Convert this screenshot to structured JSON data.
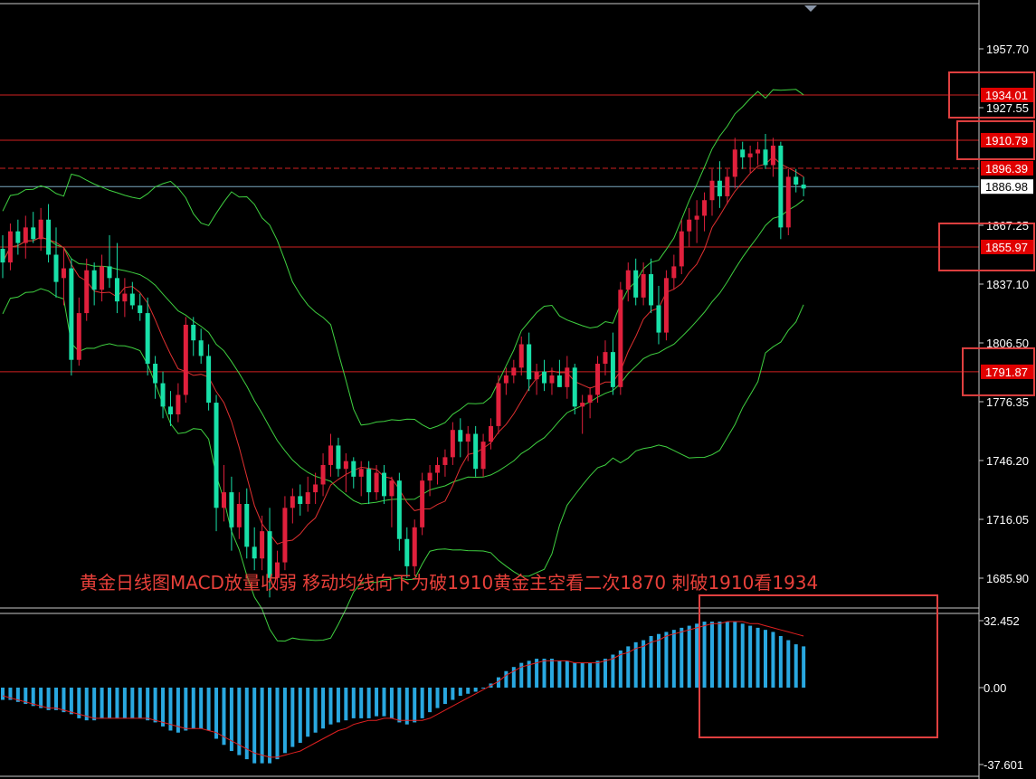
{
  "chart_data": {
    "type": "candlestick",
    "title": "",
    "annotation": "黄金日线图MACD放量收弱 移动均线向下为破1910黄金主空看二次1870 刺破1910看1934",
    "price_axis": {
      "ticks": [
        "1957.70",
        "1927.55",
        "1867.25",
        "1837.10",
        "1806.50",
        "1776.35",
        "1746.20",
        "1716.05",
        "1685.90"
      ],
      "range": [
        1676,
        1975
      ]
    },
    "macd_axis": {
      "ticks": [
        "32.452",
        "0.00",
        "-37.601"
      ],
      "range": [
        -37.601,
        32.452
      ]
    },
    "horizontal_levels": [
      {
        "label": "1934.01",
        "value": 1934.01,
        "boxed": true
      },
      {
        "label": "1910.79",
        "value": 1910.79,
        "boxed": true
      },
      {
        "label": "1896.39",
        "value": 1896.39,
        "boxed": true
      },
      {
        "label": "1855.97",
        "value": 1855.97,
        "boxed": true
      },
      {
        "label": "1791.87",
        "value": 1791.87,
        "boxed": true
      }
    ],
    "current_price": {
      "label": "1886.98",
      "value": 1886.98
    },
    "candles": [
      [
        1855,
        1862,
        1840,
        1848
      ],
      [
        1848,
        1868,
        1844,
        1864
      ],
      [
        1864,
        1870,
        1852,
        1858
      ],
      [
        1858,
        1872,
        1850,
        1866
      ],
      [
        1866,
        1874,
        1858,
        1860
      ],
      [
        1860,
        1876,
        1854,
        1870
      ],
      [
        1870,
        1878,
        1848,
        1852
      ],
      [
        1852,
        1866,
        1830,
        1838
      ],
      [
        1840,
        1856,
        1826,
        1845
      ],
      [
        1845,
        1850,
        1790,
        1798
      ],
      [
        1798,
        1830,
        1795,
        1822
      ],
      [
        1822,
        1850,
        1818,
        1844
      ],
      [
        1844,
        1848,
        1826,
        1834
      ],
      [
        1834,
        1852,
        1828,
        1846
      ],
      [
        1846,
        1862,
        1835,
        1840
      ],
      [
        1840,
        1858,
        1822,
        1828
      ],
      [
        1828,
        1840,
        1820,
        1832
      ],
      [
        1832,
        1838,
        1824,
        1826
      ],
      [
        1826,
        1832,
        1818,
        1822
      ],
      [
        1822,
        1830,
        1790,
        1796
      ],
      [
        1796,
        1800,
        1778,
        1786
      ],
      [
        1786,
        1792,
        1768,
        1774
      ],
      [
        1774,
        1782,
        1764,
        1770
      ],
      [
        1770,
        1786,
        1766,
        1780
      ],
      [
        1780,
        1820,
        1776,
        1816
      ],
      [
        1816,
        1820,
        1800,
        1808
      ],
      [
        1808,
        1814,
        1796,
        1800
      ],
      [
        1800,
        1806,
        1772,
        1776
      ],
      [
        1776,
        1780,
        1710,
        1722
      ],
      [
        1722,
        1744,
        1715,
        1730
      ],
      [
        1730,
        1738,
        1700,
        1712
      ],
      [
        1712,
        1730,
        1706,
        1724
      ],
      [
        1724,
        1732,
        1696,
        1702
      ],
      [
        1702,
        1712,
        1690,
        1696
      ],
      [
        1696,
        1718,
        1690,
        1710
      ],
      [
        1710,
        1722,
        1676,
        1686
      ],
      [
        1686,
        1700,
        1680,
        1694
      ],
      [
        1694,
        1728,
        1690,
        1722
      ],
      [
        1722,
        1732,
        1714,
        1728
      ],
      [
        1728,
        1734,
        1718,
        1724
      ],
      [
        1724,
        1738,
        1720,
        1730
      ],
      [
        1730,
        1740,
        1724,
        1734
      ],
      [
        1734,
        1750,
        1728,
        1744
      ],
      [
        1744,
        1760,
        1738,
        1754
      ],
      [
        1754,
        1758,
        1738,
        1742
      ],
      [
        1742,
        1750,
        1730,
        1746
      ],
      [
        1746,
        1748,
        1732,
        1738
      ],
      [
        1738,
        1746,
        1728,
        1742
      ],
      [
        1742,
        1746,
        1724,
        1730
      ],
      [
        1730,
        1744,
        1726,
        1740
      ],
      [
        1740,
        1744,
        1724,
        1728
      ],
      [
        1728,
        1738,
        1712,
        1736
      ],
      [
        1736,
        1740,
        1700,
        1706
      ],
      [
        1706,
        1712,
        1686,
        1692
      ],
      [
        1692,
        1716,
        1688,
        1712
      ],
      [
        1712,
        1740,
        1708,
        1736
      ],
      [
        1736,
        1744,
        1728,
        1740
      ],
      [
        1740,
        1748,
        1734,
        1744
      ],
      [
        1744,
        1752,
        1738,
        1748
      ],
      [
        1748,
        1766,
        1744,
        1762
      ],
      [
        1762,
        1768,
        1748,
        1756
      ],
      [
        1756,
        1764,
        1746,
        1760
      ],
      [
        1760,
        1764,
        1738,
        1742
      ],
      [
        1742,
        1760,
        1738,
        1756
      ],
      [
        1756,
        1768,
        1752,
        1764
      ],
      [
        1764,
        1790,
        1760,
        1786
      ],
      [
        1786,
        1794,
        1780,
        1790
      ],
      [
        1790,
        1798,
        1786,
        1794
      ],
      [
        1794,
        1810,
        1790,
        1806
      ],
      [
        1806,
        1812,
        1782,
        1788
      ],
      [
        1788,
        1796,
        1780,
        1792
      ],
      [
        1792,
        1798,
        1782,
        1786
      ],
      [
        1786,
        1794,
        1780,
        1790
      ],
      [
        1790,
        1798,
        1784,
        1784
      ],
      [
        1784,
        1800,
        1778,
        1794
      ],
      [
        1794,
        1796,
        1770,
        1774
      ],
      [
        1774,
        1780,
        1760,
        1776
      ],
      [
        1776,
        1784,
        1768,
        1780
      ],
      [
        1780,
        1800,
        1776,
        1796
      ],
      [
        1796,
        1808,
        1790,
        1802
      ],
      [
        1802,
        1812,
        1780,
        1784
      ],
      [
        1784,
        1838,
        1780,
        1834
      ],
      [
        1834,
        1848,
        1828,
        1844
      ],
      [
        1844,
        1850,
        1826,
        1830
      ],
      [
        1830,
        1848,
        1826,
        1842
      ],
      [
        1842,
        1850,
        1822,
        1826
      ],
      [
        1826,
        1836,
        1806,
        1812
      ],
      [
        1812,
        1844,
        1808,
        1840
      ],
      [
        1840,
        1852,
        1834,
        1846
      ],
      [
        1846,
        1870,
        1842,
        1864
      ],
      [
        1864,
        1876,
        1856,
        1870
      ],
      [
        1870,
        1880,
        1858,
        1872
      ],
      [
        1872,
        1884,
        1864,
        1880
      ],
      [
        1880,
        1896,
        1872,
        1890
      ],
      [
        1890,
        1900,
        1876,
        1882
      ],
      [
        1882,
        1896,
        1878,
        1892
      ],
      [
        1892,
        1912,
        1886,
        1906
      ],
      [
        1906,
        1910,
        1896,
        1902
      ],
      [
        1902,
        1908,
        1894,
        1904
      ],
      [
        1904,
        1910,
        1898,
        1906
      ],
      [
        1906,
        1914,
        1896,
        1898
      ],
      [
        1898,
        1912,
        1892,
        1908
      ],
      [
        1908,
        1910,
        1860,
        1866
      ],
      [
        1866,
        1896,
        1862,
        1892
      ],
      [
        1892,
        1896,
        1884,
        1888
      ],
      [
        1888,
        1892,
        1882,
        1886
      ]
    ],
    "macd_histogram": [
      -6,
      -6,
      -7,
      -8,
      -9,
      -10,
      -11,
      -11,
      -12,
      -13,
      -15,
      -16,
      -16,
      -15,
      -15,
      -15,
      -15,
      -15,
      -15,
      -16,
      -17,
      -19,
      -21,
      -22,
      -21,
      -20,
      -20,
      -21,
      -25,
      -28,
      -31,
      -33,
      -35,
      -37,
      -37,
      -37,
      -35,
      -32,
      -29,
      -27,
      -24,
      -22,
      -20,
      -18,
      -17,
      -16,
      -15,
      -15,
      -15,
      -14,
      -14,
      -15,
      -17,
      -18,
      -17,
      -15,
      -12,
      -10,
      -8,
      -6,
      -4,
      -3,
      -2,
      0,
      2,
      5,
      8,
      10,
      12,
      13,
      14,
      14,
      14,
      13,
      13,
      12,
      12,
      12,
      13,
      14,
      16,
      18,
      20,
      22,
      23,
      25,
      26,
      27,
      28,
      29,
      30,
      31,
      32,
      32,
      32,
      32,
      32,
      31,
      30,
      29,
      28,
      27,
      25,
      23,
      21,
      20
    ],
    "macd_signal": [
      -4,
      -5,
      -6,
      -7,
      -8,
      -9,
      -10,
      -10,
      -11,
      -12,
      -13,
      -14,
      -15,
      -15,
      -15,
      -15,
      -15,
      -15,
      -15,
      -15,
      -16,
      -17,
      -18,
      -19,
      -20,
      -20,
      -20,
      -21,
      -22,
      -24,
      -26,
      -28,
      -30,
      -32,
      -33,
      -34,
      -34,
      -33,
      -32,
      -31,
      -29,
      -27,
      -25,
      -23,
      -21,
      -20,
      -18,
      -17,
      -16,
      -16,
      -15,
      -15,
      -16,
      -16,
      -16,
      -16,
      -15,
      -13,
      -11,
      -9,
      -7,
      -5,
      -3,
      -1,
      1,
      3,
      6,
      8,
      10,
      11,
      12,
      13,
      13,
      13,
      13,
      12,
      12,
      12,
      12,
      13,
      14,
      16,
      17,
      19,
      20,
      22,
      23,
      25,
      26,
      27,
      28,
      29,
      30,
      31,
      31,
      32,
      32,
      32,
      31,
      31,
      30,
      29,
      28,
      27,
      26,
      25
    ],
    "colors": {
      "background": "#000000",
      "bull": "#e0203c",
      "bear": "#18e0a8",
      "ma": "#e03030",
      "bands": "#3fd040",
      "level": "#d02020",
      "macd_bar": "#29a8e0",
      "macd_signal": "#e02020",
      "box": "#e04040",
      "axis_text": "#ffffff"
    }
  }
}
